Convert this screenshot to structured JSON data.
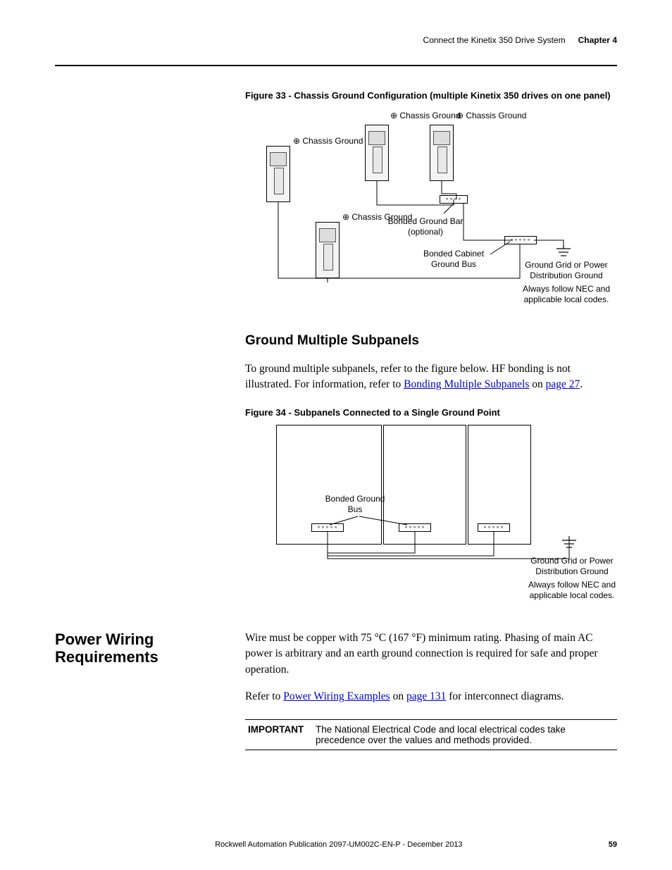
{
  "header": {
    "section": "Connect the Kinetix 350 Drive System",
    "chapter": "Chapter 4"
  },
  "fig33": {
    "title": "Figure 33 - Chassis Ground Configuration (multiple Kinetix 350 drives on one panel)",
    "labels": {
      "chassis_ground": "Chassis Ground",
      "bonded_ground_bar_line1": "Bonded Ground Bar",
      "bonded_ground_bar_line2": "(optional)",
      "bonded_cabinet_line1": "Bonded Cabinet",
      "bonded_cabinet_line2": "Ground Bus",
      "ground_grid_line1": "Ground Grid or Power",
      "ground_grid_line2": "Distribution Ground",
      "nec_line1": "Always follow NEC and",
      "nec_line2": "applicable local codes."
    }
  },
  "section_ground_multiple": {
    "heading": "Ground Multiple Subpanels",
    "para_pre": "To ground multiple subpanels, refer to the figure below. HF bonding is not illustrated. For information, refer to ",
    "link_text": "Bonding Multiple Subpanels",
    "para_mid": " on ",
    "page_link": "page 27",
    "para_end": "."
  },
  "fig34": {
    "title": "Figure 34 - Subpanels Connected to a Single Ground Point",
    "labels": {
      "bonded_bus_line1": "Bonded Ground",
      "bonded_bus_line2": "Bus",
      "ground_grid_line1": "Ground Grid or Power",
      "ground_grid_line2": "Distribution Ground",
      "nec_line1": "Always follow NEC and",
      "nec_line2": "applicable local codes."
    }
  },
  "section_power": {
    "heading": "Power Wiring Requirements",
    "para1": "Wire must be copper with 75 °C (167 °F) minimum rating. Phasing of main AC power is arbitrary and an earth ground connection is required for safe and proper operation.",
    "para2_pre": "Refer to ",
    "para2_link": "Power Wiring Examples",
    "para2_mid": " on ",
    "para2_page": "page 131",
    "para2_end": " for interconnect diagrams."
  },
  "important": {
    "label": "IMPORTANT",
    "text": "The National Electrical Code and local electrical codes take precedence over the values and methods provided."
  },
  "footer": {
    "publication": "Rockwell Automation Publication 2097-UM002C-EN-P - December 2013",
    "page": "59"
  }
}
